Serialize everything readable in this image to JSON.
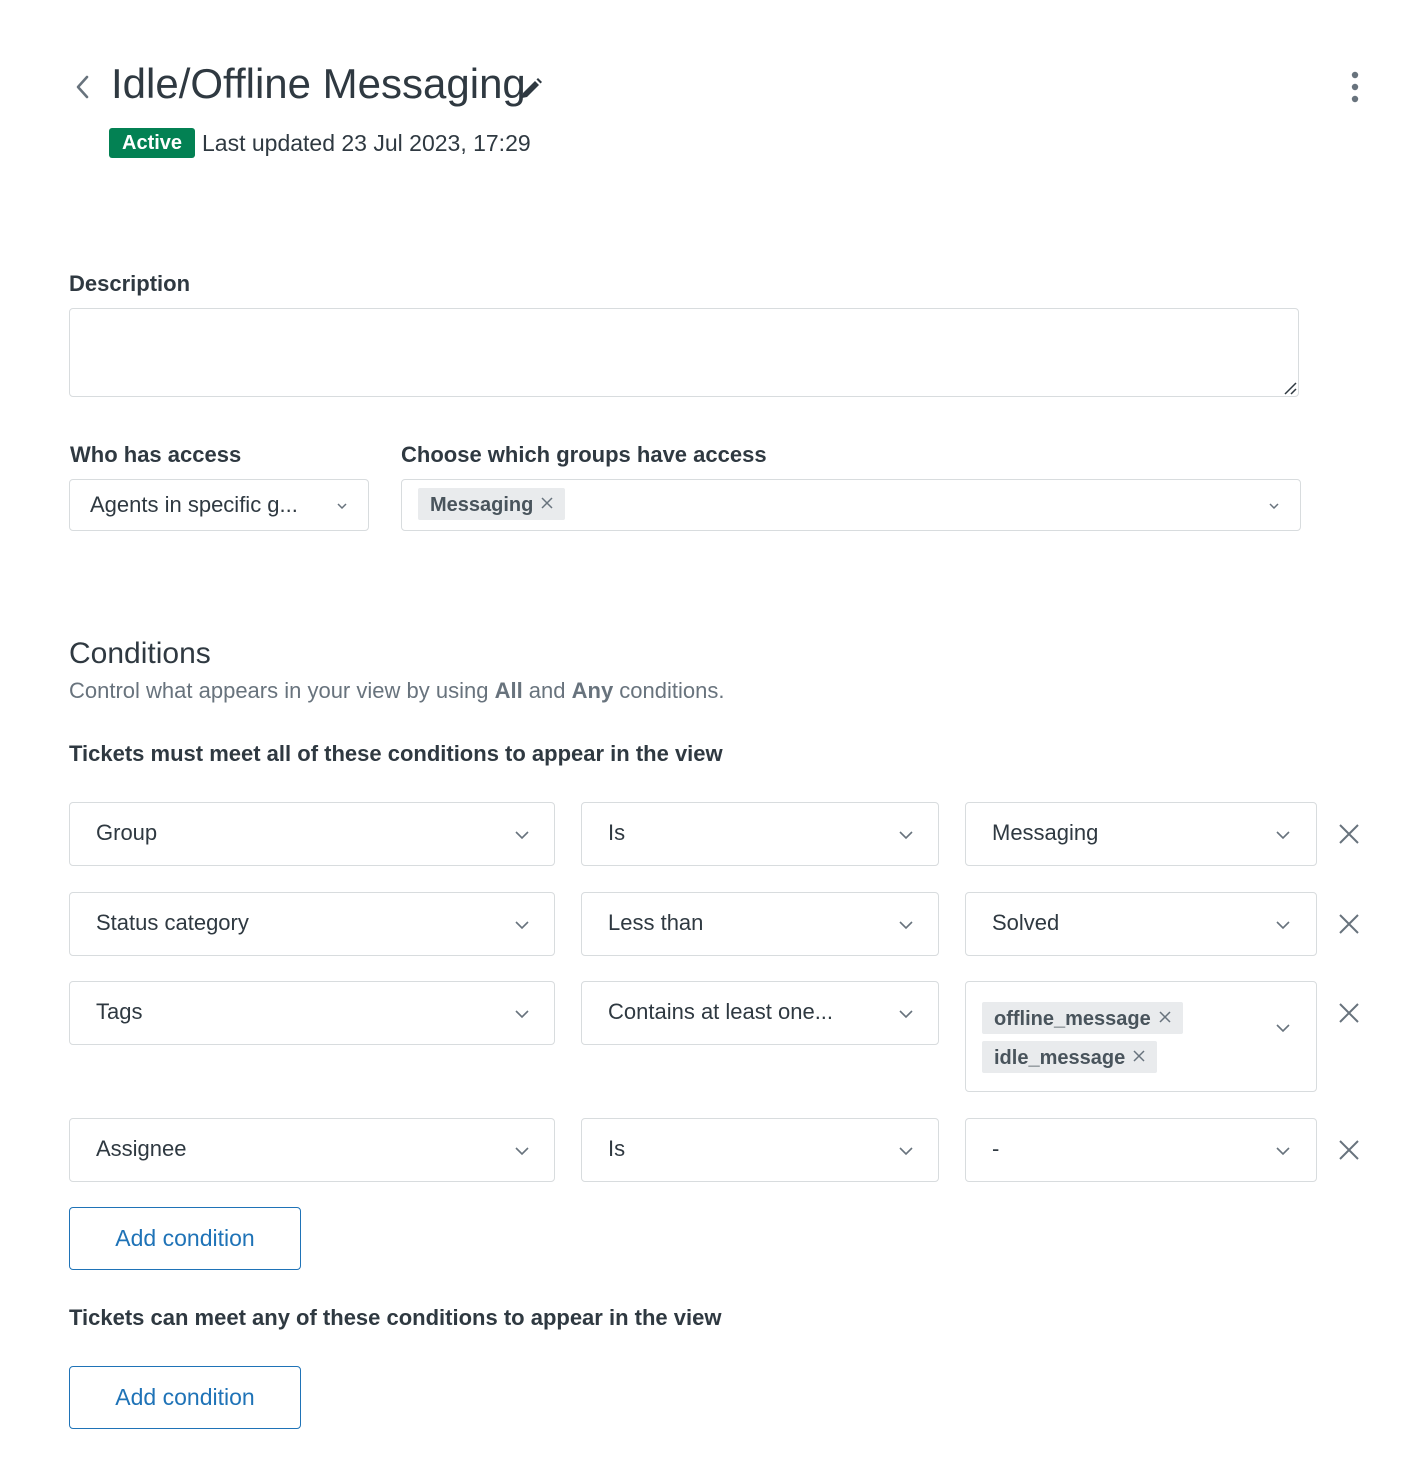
{
  "header": {
    "title": "Idle/Offline Messaging",
    "status_badge": "Active",
    "last_updated": "Last updated 23 Jul 2023, 17:29",
    "icons": {
      "back": "chevron-left-icon",
      "edit": "pencil-icon",
      "menu": "kebab-menu-icon"
    },
    "badge_color": "#038153"
  },
  "description": {
    "label": "Description",
    "value": ""
  },
  "access": {
    "who_label": "Who has access",
    "who_value": "Agents in specific g...",
    "groups_label": "Choose which groups have access",
    "groups_tags": [
      "Messaging"
    ]
  },
  "conditions": {
    "title": "Conditions",
    "desc_prefix": "Control what appears in your view by using ",
    "desc_all": "All",
    "desc_and": " and ",
    "desc_any": "Any",
    "desc_suffix": " conditions.",
    "all_heading": "Tickets must meet all of these conditions to appear in the view",
    "any_heading": "Tickets can meet any of these conditions to appear in the view",
    "all_rows": [
      {
        "field": "Group",
        "operator": "Is",
        "value": "Messaging"
      },
      {
        "field": "Status category",
        "operator": "Less than",
        "value": "Solved"
      },
      {
        "field": "Tags",
        "operator": "Contains at least one...",
        "tags": [
          "offline_message",
          "idle_message"
        ]
      },
      {
        "field": "Assignee",
        "operator": "Is",
        "value": "-"
      }
    ],
    "add_condition_label": "Add condition",
    "add_condition_any_label": "Add condition"
  },
  "colors": {
    "text": "#2f3941",
    "muted": "#68737d",
    "border": "#d8dcde",
    "link": "#1f73b7",
    "tag_bg": "#e9ebed"
  }
}
